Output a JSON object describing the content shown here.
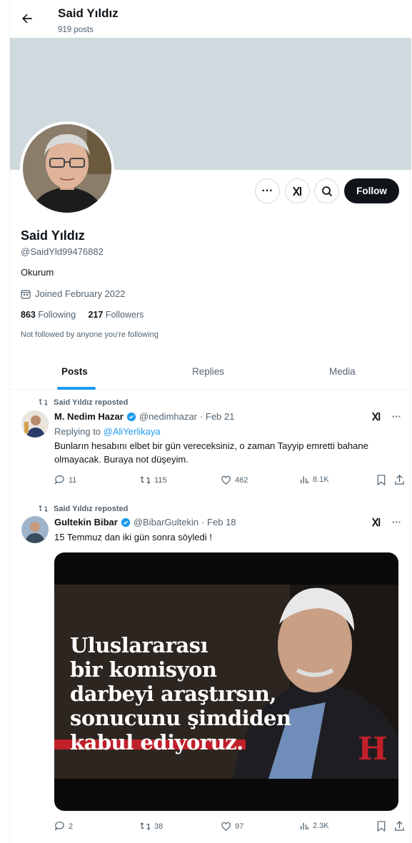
{
  "header": {
    "name": "Said Yıldız",
    "post_count": "919 posts"
  },
  "profile": {
    "display_name": "Said Yıldız",
    "handle": "@SaidYld99476882",
    "bio": "Okurum",
    "joined": "Joined February 2022",
    "following_count": "863",
    "following_label": "Following",
    "followers_count": "217",
    "followers_label": "Followers",
    "not_followed_note": "Not followed by anyone you're following",
    "follow_label": "Follow"
  },
  "tabs": [
    {
      "label": "Posts"
    },
    {
      "label": "Replies"
    },
    {
      "label": "Media"
    }
  ],
  "posts": [
    {
      "repost_label": "Said Yıldız reposted",
      "author": "M. Nedim Hazar",
      "handle": "@nedimhazar",
      "date": "· Feb 21",
      "replying_prefix": "Replying to",
      "replying_handle": "@AliYerlikaya",
      "text": "Bunların hesabını elbet bir gün vereceksiniz, o zaman Tayyip emretti bahane olmayacak. Buraya not düşeyim.",
      "replies": "11",
      "reposts": "115",
      "likes": "462",
      "views": "8.1K"
    },
    {
      "repost_label": "Said Yıldız reposted",
      "author": "Gultekin Bibar",
      "handle": "@BibarGultekin",
      "date": "· Feb 18",
      "text": "15 Temmuz dan iki gün sonra söyledi !",
      "image_text": [
        "Uluslararası",
        "bir komisyon",
        "darbeyi araştırsın,",
        "sonucunu şimdiden",
        "kabul ediyoruz."
      ],
      "replies": "2",
      "reposts": "38",
      "likes": "97",
      "views": "2.3K"
    }
  ],
  "colors": {
    "accent": "#1d9bf0",
    "text": "#0f1419",
    "muted": "#536471",
    "banner": "#cfd9de"
  }
}
